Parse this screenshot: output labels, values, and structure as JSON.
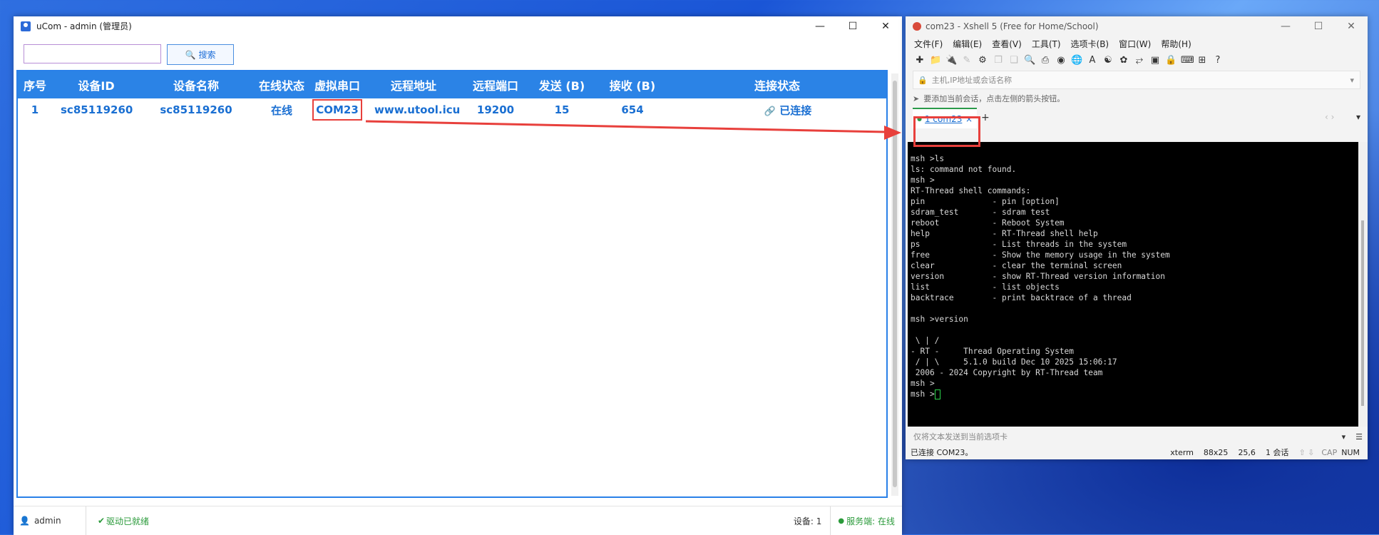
{
  "ucom": {
    "title": "uCom - admin (管理员)",
    "search_input_value": "",
    "search_button": "搜索",
    "columns": [
      "序号",
      "设备ID",
      "设备名称",
      "在线状态",
      "虚拟串口",
      "远程地址",
      "远程端口",
      "发送 (B)",
      "接收 (B)",
      "连接状态"
    ],
    "row": {
      "index": "1",
      "device_id": "sc85119260",
      "device_name": "sc85119260",
      "online": "在线",
      "com": "COM23",
      "address": "www.utool.icu",
      "port": "19200",
      "sent": "15",
      "recv": "654",
      "conn": "已连接"
    },
    "status": {
      "user": "admin",
      "driver": "驱动已就绪",
      "devices": "设备: 1",
      "server": "服务端: 在线"
    },
    "colors": {
      "header": "#2b83e6",
      "text": "#1a6fd2",
      "highlight": "#e8403c",
      "ok": "#2a9a3a"
    }
  },
  "xshell": {
    "title": "com23 - Xshell 5 (Free for Home/School)",
    "menu": [
      "文件(F)",
      "编辑(E)",
      "查看(V)",
      "工具(T)",
      "选项卡(B)",
      "窗口(W)",
      "帮助(H)"
    ],
    "address_placeholder": "主机,IP地址或会话名称",
    "hint": "要添加当前会话，点击左侧的箭头按钮。",
    "tab_label": "1 com23",
    "terminal_lines": [
      "msh >ls",
      "ls: command not found.",
      "msh >",
      "RT-Thread shell commands:",
      "pin              - pin [option]",
      "sdram_test       - sdram test",
      "reboot           - Reboot System",
      "help             - RT-Thread shell help",
      "ps               - List threads in the system",
      "free             - Show the memory usage in the system",
      "clear            - clear the terminal screen",
      "version          - show RT-Thread version information",
      "list             - list objects",
      "backtrace        - print backtrace of a thread",
      "",
      "msh >version",
      "",
      " \\ | /",
      "- RT -     Thread Operating System",
      " / | \\     5.1.0 build Dec 10 2025 15:06:17",
      " 2006 - 2024 Copyright by RT-Thread team",
      "msh >",
      "msh >"
    ],
    "send_placeholder": "仅将文本发送到当前选项卡",
    "status": {
      "connected": "已连接 COM23。",
      "term": "xterm",
      "size": "88x25",
      "pos": "25,6",
      "sessions": "1 会话",
      "cap": "CAP",
      "num": "NUM"
    }
  }
}
